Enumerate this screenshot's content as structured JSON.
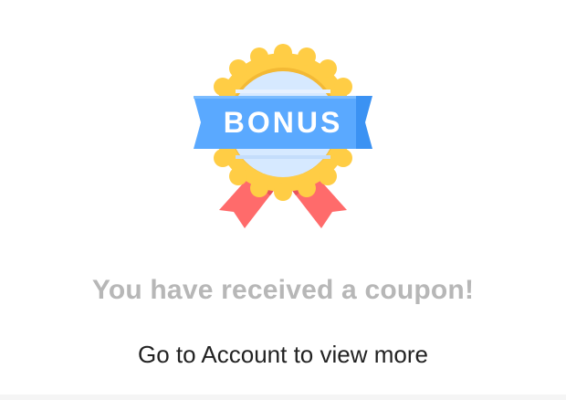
{
  "badge": {
    "label": "BONUS",
    "icon": "bonus-badge-icon",
    "colors": {
      "seal": "#ffcd45",
      "seal_inner": "#d6e9ff",
      "ribbon": "#5aa9ff",
      "ribbon_fold": "#3b92f3",
      "tails": "#ff6b6b"
    }
  },
  "message": {
    "title": "You have received a coupon!",
    "subtitle_prefix": "Go to ",
    "subtitle_link": "Account",
    "subtitle_suffix": " to view more"
  }
}
